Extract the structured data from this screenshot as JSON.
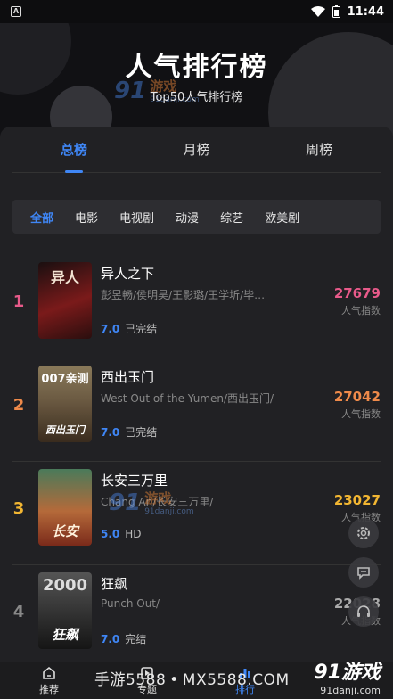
{
  "status_bar": {
    "app_icon": "A",
    "time": "11:44",
    "icons": [
      "wifi-icon",
      "battery-icon"
    ]
  },
  "header": {
    "title": "人气排行榜",
    "subtitle": "Top50人气排行榜"
  },
  "watermark": {
    "num": "91",
    "text": "游戏",
    "domain": "91danji.com"
  },
  "tabs": [
    {
      "label": "总榜",
      "active": true
    },
    {
      "label": "月榜",
      "active": false
    },
    {
      "label": "周榜",
      "active": false
    }
  ],
  "filters": [
    {
      "label": "全部",
      "active": true
    },
    {
      "label": "电影",
      "active": false
    },
    {
      "label": "电视剧",
      "active": false
    },
    {
      "label": "动漫",
      "active": false
    },
    {
      "label": "综艺",
      "active": false
    },
    {
      "label": "欧美剧",
      "active": false
    }
  ],
  "items": [
    {
      "rank": "1",
      "rank_color": "#e85a8a",
      "title": "异人之下",
      "cast": "彭昱畅/侯明昊/王影璐/王学圻/毕…",
      "score": "7.0",
      "status": "已完结",
      "heat": "27679",
      "heat_color": "#e85a8a",
      "heat_label": "人气指数",
      "poster_top": "异人",
      "poster_bottom": "",
      "poster_bg": "#7a1a1a"
    },
    {
      "rank": "2",
      "rank_color": "#ef8a4a",
      "title": "西出玉门",
      "cast": "West Out of the Yumen/西出玉门/",
      "score": "7.0",
      "status": "已完结",
      "heat": "27042",
      "heat_color": "#ef8a4a",
      "heat_label": "人气指数",
      "poster_top": "007亲测",
      "poster_bottom": "西出玉门",
      "poster_bg": "#6b5a42"
    },
    {
      "rank": "3",
      "rank_color": "#f2b632",
      "title": "长安三万里",
      "cast": "Chang An/长安三万里/",
      "score": "5.0",
      "status": "HD",
      "heat": "23027",
      "heat_color": "#f2b632",
      "heat_label": "人气指数",
      "poster_top": "",
      "poster_bottom": "长安",
      "poster_bg": "#7a5a3a"
    },
    {
      "rank": "4",
      "rank_color": "#888888",
      "title": "狂飙",
      "cast": "Punch Out/",
      "score": "7.0",
      "status": "完结",
      "heat": "22028",
      "heat_color": "#aaaaaa",
      "heat_label": "人气指数",
      "poster_top": "2000",
      "poster_bottom": "狂飙",
      "poster_bg": "#3c3c3c"
    }
  ],
  "float_buttons": [
    "gear-icon",
    "chat-icon",
    "headset-icon"
  ],
  "bottom_nav": [
    {
      "label": "推荐",
      "icon": "home-icon",
      "active": false
    },
    {
      "label": "专题",
      "icon": "topic-icon",
      "active": false
    },
    {
      "label": "排行",
      "icon": "rank-icon",
      "active": true
    },
    {
      "label": "",
      "icon": "",
      "active": false
    }
  ],
  "site_watermark": {
    "left": "手游5588",
    "dot": "•",
    "right": "MX5588.COM"
  },
  "brand_watermark": {
    "logo": "91游戏",
    "domain": "91danji.com"
  }
}
